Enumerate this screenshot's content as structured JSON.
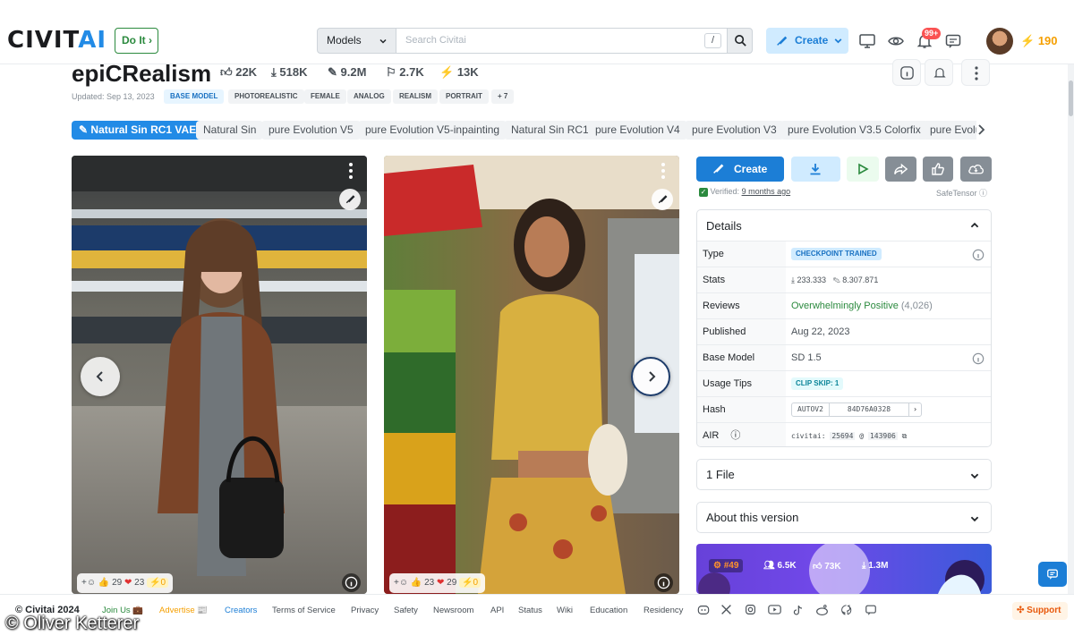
{
  "header": {
    "logo_main": "CIVIT",
    "logo_accent": "AI",
    "do_it_label": "Do It",
    "search_scope": "Models",
    "search_placeholder": "Search Civitai",
    "search_shortcut": "/",
    "create_label": "Create",
    "notification_count": "99+",
    "buzz_balance": "190"
  },
  "model": {
    "title": "epiCRealism",
    "likes": "22K",
    "downloads": "518K",
    "generations": "9.2M",
    "bookmarks": "2.7K",
    "buzz": "13K",
    "updated": "Updated: Sep 13, 2023",
    "tags": [
      "BASE MODEL",
      "PHOTOREALISTIC",
      "FEMALE",
      "ANALOG",
      "REALISM",
      "PORTRAIT",
      "+ 7"
    ]
  },
  "versions": [
    "Natural Sin RC1 VAE",
    "Natural Sin",
    "pure Evolution V5",
    "pure Evolution V5-inpainting",
    "Natural Sin RC1",
    "pure Evolution V4",
    "pure Evolution V3",
    "pure Evolution V3.5 Colorfix",
    "pure Evolu"
  ],
  "images": [
    {
      "reactions": {
        "likes": "29",
        "hearts": "23",
        "buzz": "0"
      }
    },
    {
      "reactions": {
        "likes": "23",
        "hearts": "29",
        "buzz": "0"
      }
    }
  ],
  "actions": {
    "create_label": "Create",
    "verified_prefix": "Verified:",
    "verified_time": "9 months ago",
    "safetensor": "SafeTensor"
  },
  "details": {
    "header": "Details",
    "rows": {
      "type_label": "Type",
      "type_value": "CHECKPOINT TRAINED",
      "stats_label": "Stats",
      "stats_downloads": "233.333",
      "stats_generations": "8.307.871",
      "reviews_label": "Reviews",
      "reviews_value": "Overwhelmingly Positive",
      "reviews_count": "(4,026)",
      "published_label": "Published",
      "published_value": "Aug 22, 2023",
      "base_label": "Base Model",
      "base_value": "SD 1.5",
      "usage_label": "Usage Tips",
      "usage_value": "CLIP SKIP: 1",
      "hash_label": "Hash",
      "hash_type": "AUTOV2",
      "hash_value": "84D76A0328",
      "air_label": "AIR",
      "air_prefix": "civitai:",
      "air_model": "25694",
      "air_at": "@",
      "air_version": "143906"
    }
  },
  "files_label": "1 File",
  "about_label": "About this version",
  "promo": {
    "rank": "#49",
    "followers": "6.5K",
    "likes": "73K",
    "downloads": "1.3M"
  },
  "footer": {
    "copyright": "© Civitai 2024",
    "links": [
      "Join Us 💼",
      "Advertise 📰",
      "Creators",
      "Terms of Service",
      "Privacy",
      "Safety",
      "Newsroom",
      "API",
      "Status",
      "Wiki",
      "Education",
      "Residency"
    ],
    "support": "Support"
  },
  "watermark": "© Oliver Ketterer",
  "colors": {
    "accent": "#228be6",
    "green": "#2b8a3e",
    "buzz": "#f59f00",
    "red": "#fa5252"
  }
}
